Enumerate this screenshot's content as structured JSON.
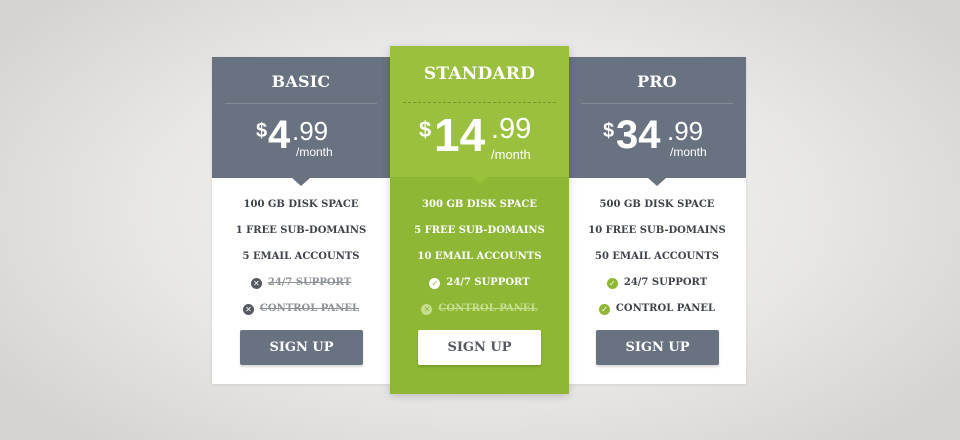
{
  "plans": {
    "basic": {
      "name": "BASIC",
      "currency": "$",
      "dollars": "4",
      "cents": ".99",
      "period": "/month",
      "features": [
        {
          "text": "100 GB DISK SPACE"
        },
        {
          "text": "1 FREE SUB-DOMAINS"
        },
        {
          "text": "5 EMAIL ACCOUNTS"
        },
        {
          "text": "24/7 SUPPORT",
          "icon": "x-circle-icon"
        },
        {
          "text": "CONTROL PANEL",
          "icon": "x-circle-icon"
        }
      ],
      "button": "SIGN UP"
    },
    "standard": {
      "name": "STANDARD",
      "currency": "$",
      "dollars": "14",
      "cents": ".99",
      "period": "/month",
      "features": [
        {
          "text": "300 GB DISK SPACE"
        },
        {
          "text": "5 FREE SUB-DOMAINS"
        },
        {
          "text": "10 EMAIL ACCOUNTS"
        },
        {
          "text": "24/7 SUPPORT",
          "icon": "check-circle-icon"
        },
        {
          "text": "CONTROL PANEL",
          "icon": "x-circle-icon"
        }
      ],
      "button": "SIGN UP"
    },
    "pro": {
      "name": "PRO",
      "currency": "$",
      "dollars": "34",
      "cents": ".99",
      "period": "/month",
      "features": [
        {
          "text": "500 GB DISK SPACE"
        },
        {
          "text": "10 FREE SUB-DOMAINS"
        },
        {
          "text": "50 EMAIL ACCOUNTS"
        },
        {
          "text": "24/7 SUPPORT",
          "icon": "check-circle-icon"
        },
        {
          "text": "CONTROL PANEL",
          "icon": "check-circle-icon"
        }
      ],
      "button": "SIGN UP"
    }
  },
  "colors": {
    "header_gray": "#687280",
    "accent_green": "#9ac03d",
    "accent_green_dark": "#8db734",
    "card_white": "#ffffff",
    "text_dark": "#3e4249"
  }
}
